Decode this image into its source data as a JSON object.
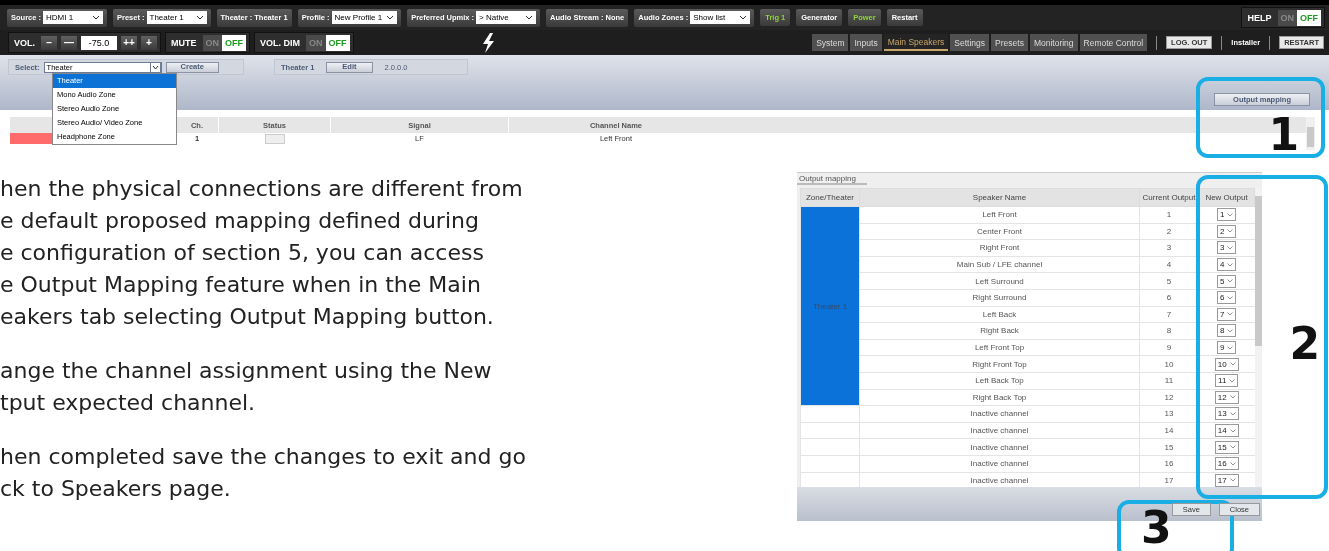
{
  "top_screenshot": {
    "toolbar_row_1": {
      "fields": [
        {
          "kind": "select",
          "label": "Source :",
          "value": "HDMI 1"
        },
        {
          "kind": "select",
          "label": "Preset :",
          "value": "Theater 1"
        },
        {
          "kind": "info",
          "label": "Theater : Theater 1"
        },
        {
          "kind": "select",
          "label": "Profile :",
          "value": "New Profile 1"
        },
        {
          "kind": "select",
          "label": "Preferred Upmix :",
          "value": "> Native"
        },
        {
          "kind": "info",
          "label": "Audio Stream : None"
        },
        {
          "kind": "select",
          "label": "Audio Zones :",
          "value": "Show list"
        }
      ],
      "buttons": [
        {
          "label": "Trig 1",
          "on": true
        },
        {
          "label": "Generator",
          "on": false
        },
        {
          "label": "Power",
          "on": true
        },
        {
          "label": "Restart",
          "on": false
        }
      ],
      "help": {
        "label": "HELP",
        "on_label": "ON",
        "off_label": "OFF",
        "on": false
      }
    },
    "toolbar_row_2": {
      "volume": {
        "label": "VOL.",
        "buttons_before": [
          "–",
          "—"
        ],
        "value": "-75.0",
        "buttons_after": [
          "++",
          "+"
        ]
      },
      "toggles": [
        {
          "label": "MUTE",
          "on_label": "ON",
          "off_label": "OFF",
          "on": false
        },
        {
          "label": "VOL. DIM",
          "on_label": "ON",
          "off_label": "OFF",
          "on": false
        }
      ],
      "tabs": [
        {
          "label": "System",
          "selected": false
        },
        {
          "label": "Inputs",
          "selected": false
        },
        {
          "label": "Main Speakers",
          "selected": true
        },
        {
          "label": "Settings",
          "selected": false
        },
        {
          "label": "Presets",
          "selected": false
        },
        {
          "label": "Monitoring",
          "selected": false
        },
        {
          "label": "Remote Control",
          "selected": false
        }
      ],
      "logout": "LOG. OUT",
      "user": "Installer",
      "restart": "RESTART"
    },
    "zone_bar": {
      "select_label": "Select:",
      "select_value": "Theater",
      "create": "Create",
      "zone_name": "Theater 1",
      "edit": "Edit",
      "version": "2.0.0.0",
      "output_mapping": "Output mapping",
      "dropdown": [
        {
          "label": "Theater",
          "selected": true
        },
        {
          "label": "Mono Audio Zone",
          "selected": false
        },
        {
          "label": "Stereo Audio Zone",
          "selected": false
        },
        {
          "label": "Stereo Audio/ Video Zone",
          "selected": false
        },
        {
          "label": "Headphone Zone",
          "selected": false
        }
      ]
    },
    "table": {
      "columns": [
        "Ch.",
        "Status",
        "Signal",
        "Channel Name"
      ],
      "rows": [
        {
          "ch": "1",
          "signal": "LF",
          "channel_name": "Left Front"
        }
      ]
    }
  },
  "instructions": [
    {
      "lines": [
        "hen the physical connections are different from",
        "e default proposed mapping defined during",
        "e configuration of section 5, you can access",
        "e Output Mapping feature when in the Main",
        "eakers tab selecting Output Mapping button."
      ]
    },
    {
      "lines": [
        "ange the channel assignment using the New",
        "tput expected channel."
      ]
    },
    {
      "lines": [
        "hen completed save the changes to exit and go",
        "ck to Speakers page."
      ]
    }
  ],
  "output_mapping_dialog": {
    "title": "Output mapping",
    "columns": [
      "Zone/Theater",
      "Speaker Name",
      "Current Output",
      "New Output"
    ],
    "zone": "Theater 1",
    "rows": [
      {
        "in_zone": true,
        "speaker": "Left Front",
        "current": "1",
        "new": "1"
      },
      {
        "in_zone": true,
        "speaker": "Center Front",
        "current": "2",
        "new": "2"
      },
      {
        "in_zone": true,
        "speaker": "Right Front",
        "current": "3",
        "new": "3"
      },
      {
        "in_zone": true,
        "speaker": "Main Sub / LFE channel",
        "current": "4",
        "new": "4"
      },
      {
        "in_zone": true,
        "speaker": "Left Surround",
        "current": "5",
        "new": "5"
      },
      {
        "in_zone": true,
        "speaker": "Right Surround",
        "current": "6",
        "new": "6"
      },
      {
        "in_zone": true,
        "speaker": "Left Back",
        "current": "7",
        "new": "7"
      },
      {
        "in_zone": true,
        "speaker": "Right Back",
        "current": "8",
        "new": "8"
      },
      {
        "in_zone": true,
        "speaker": "Left Front Top",
        "current": "9",
        "new": "9"
      },
      {
        "in_zone": true,
        "speaker": "Right Front Top",
        "current": "10",
        "new": "10"
      },
      {
        "in_zone": true,
        "speaker": "Left Back Top",
        "current": "11",
        "new": "11"
      },
      {
        "in_zone": true,
        "speaker": "Right Back Top",
        "current": "12",
        "new": "12"
      },
      {
        "in_zone": false,
        "speaker": "Inactive channel",
        "current": "13",
        "new": "13"
      },
      {
        "in_zone": false,
        "speaker": "Inactive channel",
        "current": "14",
        "new": "14"
      },
      {
        "in_zone": false,
        "speaker": "Inactive channel",
        "current": "15",
        "new": "15"
      },
      {
        "in_zone": false,
        "speaker": "Inactive channel",
        "current": "16",
        "new": "16"
      },
      {
        "in_zone": false,
        "speaker": "Inactive channel",
        "current": "17",
        "new": "17"
      }
    ],
    "buttons": [
      "Save",
      "Close"
    ]
  },
  "callouts": [
    "1",
    "2",
    "3"
  ]
}
